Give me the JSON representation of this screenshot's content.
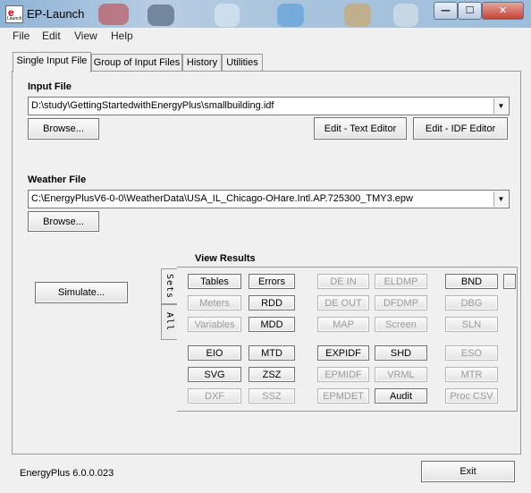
{
  "window": {
    "title": "EP-Launch",
    "icon_text": "e",
    "icon_subtext": "Launch",
    "controls": {
      "minimize": "—",
      "maximize": "☐",
      "close": "✕"
    }
  },
  "menu": [
    "File",
    "Edit",
    "View",
    "Help"
  ],
  "tabs": [
    "Single Input File",
    "Group of Input Files",
    "History",
    "Utilities"
  ],
  "input_file": {
    "label": "Input File",
    "value": "D:\\study\\GettingStartedwithEnergyPlus\\smallbuilding.idf",
    "browse": "Browse...",
    "edit_text": "Edit - Text Editor",
    "edit_idf": "Edit - IDF Editor"
  },
  "weather_file": {
    "label": "Weather File",
    "value": "C:\\EnergyPlusV6-0-0\\WeatherData\\USA_IL_Chicago-OHare.Intl.AP.725300_TMY3.epw",
    "browse": "Browse..."
  },
  "simulate": "Simulate...",
  "view_results": {
    "label": "View Results",
    "side_tabs": [
      "Sets",
      "All"
    ],
    "buttons": [
      [
        "Tables",
        "Errors",
        "DE IN",
        "ELDMP",
        "BND"
      ],
      [
        "Meters",
        "RDD",
        "DE OUT",
        "DFDMP",
        "DBG"
      ],
      [
        "Variables",
        "MDD",
        "MAP",
        "Screen",
        "SLN"
      ],
      [
        "EIO",
        "MTD",
        "EXPIDF",
        "SHD",
        "ESO"
      ],
      [
        "SVG",
        "ZSZ",
        "EPMIDF",
        "VRML",
        "MTR"
      ],
      [
        "DXF",
        "SSZ",
        "EPMDET",
        "Audit",
        "Proc CSV"
      ]
    ],
    "enabled": [
      [
        true,
        true,
        false,
        false,
        true
      ],
      [
        false,
        true,
        false,
        false,
        false
      ],
      [
        false,
        true,
        false,
        false,
        false
      ],
      [
        true,
        true,
        true,
        true,
        false
      ],
      [
        true,
        true,
        false,
        false,
        false
      ],
      [
        false,
        false,
        false,
        true,
        false
      ]
    ]
  },
  "status": {
    "version": "EnergyPlus 6.0.0.023"
  },
  "exit": "Exit"
}
